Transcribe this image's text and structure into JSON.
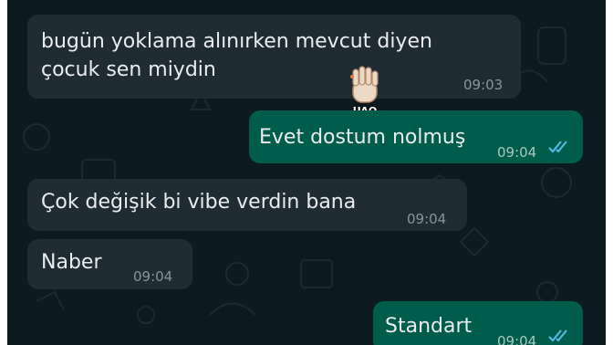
{
  "messages": [
    {
      "direction": "incoming",
      "text": "bugün yoklama alınırken mevcut diyen\nçocuk sen miydin",
      "time": "09:03"
    },
    {
      "direction": "outgoing",
      "text": "Evet dostum nolmuş",
      "time": "09:04",
      "read": true
    },
    {
      "direction": "incoming",
      "text": "Çok değişik bi vibe verdin bana",
      "time": "09:04"
    },
    {
      "direction": "incoming",
      "text": "Naber",
      "time": "09:04"
    },
    {
      "direction": "outgoing",
      "text": "Standart",
      "time": "09:04",
      "read": true
    }
  ],
  "sticker": {
    "label": "UAQ",
    "icon": "waving-hand-icon"
  },
  "colors": {
    "background": "#0d1a1f",
    "incoming_bubble": "#1f2c33",
    "outgoing_bubble": "#005c4b",
    "read_ticks": "#53bdeb"
  }
}
